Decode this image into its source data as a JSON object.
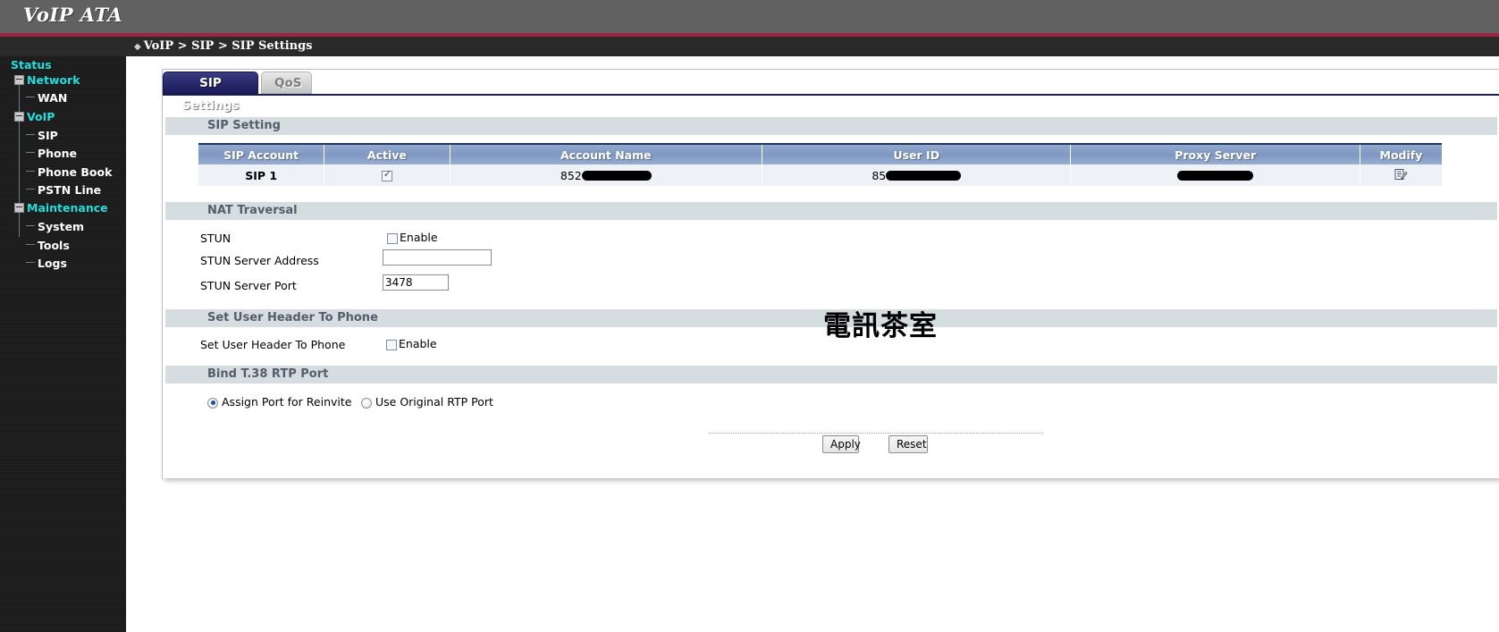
{
  "header": {
    "brand": "VoIP ATA",
    "breadcrumb_diamond": "◆",
    "breadcrumb": "VoIP > SIP > SIP Settings"
  },
  "sidebar": {
    "items": [
      {
        "label": "Status",
        "level": "root",
        "icon": "",
        "expander": false
      },
      {
        "label": "Network",
        "level": "root",
        "icon": "minus-box-icon",
        "expander": true
      },
      {
        "label": "WAN",
        "level": "child",
        "icon": "tree-branch-icon",
        "expander": false
      },
      {
        "label": "VoIP",
        "level": "root",
        "icon": "minus-box-icon",
        "expander": true
      },
      {
        "label": "SIP",
        "level": "child",
        "icon": "tree-branch-icon",
        "expander": false
      },
      {
        "label": "Phone",
        "level": "child",
        "icon": "tree-branch-icon",
        "expander": false
      },
      {
        "label": "Phone Book",
        "level": "child",
        "icon": "tree-branch-icon",
        "expander": false
      },
      {
        "label": "PSTN Line",
        "level": "child",
        "icon": "tree-branch-icon",
        "expander": false
      },
      {
        "label": "Maintenance",
        "level": "root",
        "icon": "minus-box-icon",
        "expander": true
      },
      {
        "label": "System",
        "level": "child",
        "icon": "tree-branch-icon",
        "expander": false
      },
      {
        "label": "Tools",
        "level": "child",
        "icon": "tree-branch-icon",
        "expander": false
      },
      {
        "label": "Logs",
        "level": "child",
        "icon": "tree-branch-icon",
        "expander": false
      }
    ]
  },
  "tabs": [
    {
      "label": "SIP Settings",
      "active": true
    },
    {
      "label": "QoS",
      "active": false
    }
  ],
  "sections": {
    "sip_setting": {
      "title": "SIP Setting"
    },
    "nat_traversal": {
      "title": "NAT Traversal"
    },
    "set_user_header": {
      "title": "Set User Header To Phone"
    },
    "bind_t38": {
      "title": "Bind T.38 RTP Port"
    }
  },
  "sip_table": {
    "columns": [
      "SIP Account",
      "Active",
      "Account Name",
      "User ID",
      "Proxy Server",
      "Modify"
    ],
    "rows": [
      {
        "sip_account": "SIP 1",
        "active": true,
        "account_name_prefix": "852",
        "account_name_redacted": true,
        "user_id_prefix": "85",
        "user_id_redacted": true,
        "proxy_server_prefix": "",
        "proxy_server_redacted": true,
        "modify_icon": "edit-page-icon"
      }
    ]
  },
  "nat_traversal": {
    "stun_label": "STUN",
    "stun_enable_label": "Enable",
    "stun_enabled": false,
    "server_address_label": "STUN Server Address",
    "server_address_value": "",
    "server_address_placeholder": "",
    "server_port_label": "STUN Server Port",
    "server_port_value": "3478"
  },
  "set_user_header": {
    "label": "Set User Header To Phone",
    "enable_label": "Enable",
    "enabled": false
  },
  "bind_t38": {
    "options": [
      {
        "label": "Assign Port for Reinvite",
        "selected": true
      },
      {
        "label": "Use Original RTP Port",
        "selected": false
      }
    ]
  },
  "buttons": {
    "apply": "Apply",
    "reset": "Reset"
  },
  "watermark": "電訊茶室",
  "colors": {
    "banner": "#616161",
    "accent_red": "#9e2440",
    "sidebar_bg": "#1c1c1c",
    "nav_root": "#24dede",
    "nav_child": "#ffffff",
    "tab_active": "#1d1d5c",
    "table_header": "#7f97c3",
    "section_bar": "#d6dde0"
  }
}
